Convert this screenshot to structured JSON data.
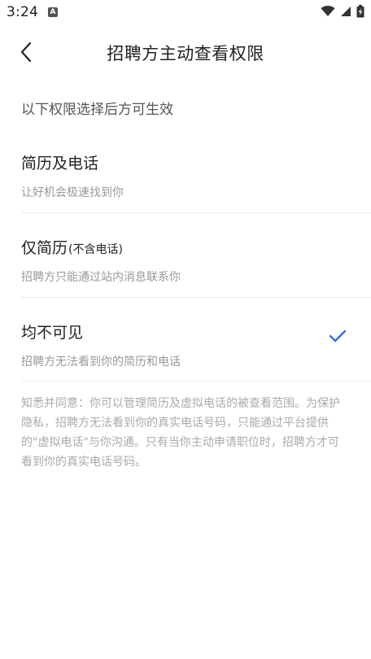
{
  "status_bar": {
    "time": "3:24",
    "app_icon": "A"
  },
  "header": {
    "title": "招聘方主动查看权限"
  },
  "hint": "以下权限选择后方可生效",
  "options": [
    {
      "title": "简历及电话",
      "note": "",
      "desc": "让好机会极速找到你",
      "selected": false
    },
    {
      "title": "仅简历",
      "note": "(不含电话)",
      "desc": "招聘方只能通过站内消息联系你",
      "selected": false
    },
    {
      "title": "均不可见",
      "note": "",
      "desc": "招聘方无法看到你的简历和电话",
      "selected": true
    }
  ],
  "notice": "知悉并同意：你可以管理简历及虚拟电话的被查看范围。为保护隐私，招聘方无法看到你的真实电话号码，只能通过平台提供的\"虚拟电话\"与你沟通。只有当你主动申请职位时，招聘方才可看到你的真实电话号码。",
  "colors": {
    "accent": "#2f6fe4",
    "text_primary": "#222222",
    "text_secondary": "#999999",
    "notice_text": "#aaaaaa"
  }
}
